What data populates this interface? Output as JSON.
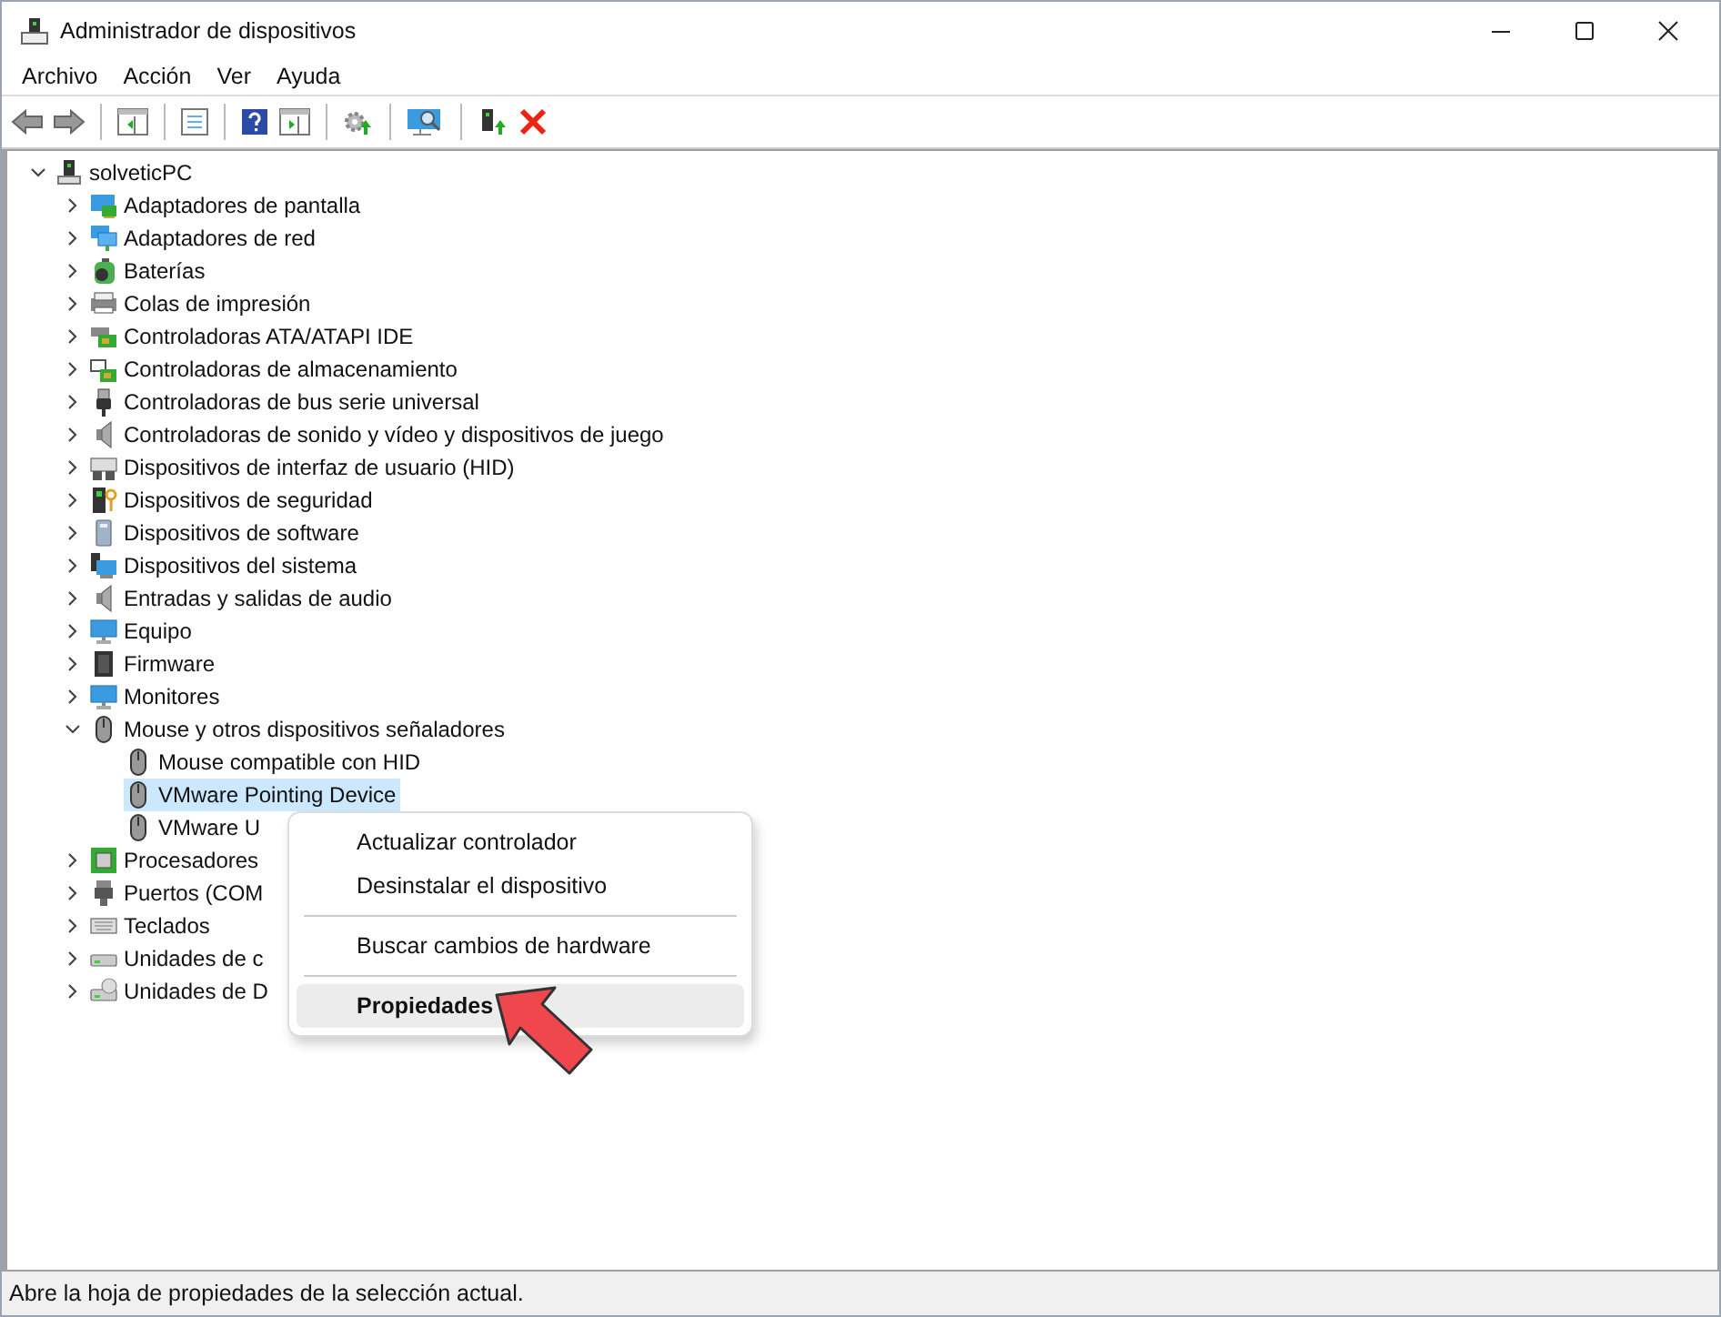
{
  "window": {
    "title": "Administrador de dispositivos"
  },
  "menu_bar": [
    "Archivo",
    "Acción",
    "Ver",
    "Ayuda"
  ],
  "tree": {
    "label": "solveticPC",
    "expanded": true,
    "selected": false,
    "children": [
      {
        "label": "Adaptadores de pantalla",
        "expanded": false,
        "selected": false
      },
      {
        "label": "Adaptadores de red",
        "expanded": false,
        "selected": false
      },
      {
        "label": "Baterías",
        "expanded": false,
        "selected": false
      },
      {
        "label": "Colas de impresión",
        "expanded": false,
        "selected": false
      },
      {
        "label": "Controladoras ATA/ATAPI IDE",
        "expanded": false,
        "selected": false
      },
      {
        "label": "Controladoras de almacenamiento",
        "expanded": false,
        "selected": false
      },
      {
        "label": "Controladoras de bus serie universal",
        "expanded": false,
        "selected": false
      },
      {
        "label": "Controladoras de sonido y vídeo y dispositivos de juego",
        "expanded": false,
        "selected": false
      },
      {
        "label": "Dispositivos de interfaz de usuario (HID)",
        "expanded": false,
        "selected": false
      },
      {
        "label": "Dispositivos de seguridad",
        "expanded": false,
        "selected": false
      },
      {
        "label": "Dispositivos de software",
        "expanded": false,
        "selected": false
      },
      {
        "label": "Dispositivos del sistema",
        "expanded": false,
        "selected": false
      },
      {
        "label": "Entradas y salidas de audio",
        "expanded": false,
        "selected": false
      },
      {
        "label": "Equipo",
        "expanded": false,
        "selected": false
      },
      {
        "label": "Firmware",
        "expanded": false,
        "selected": false
      },
      {
        "label": "Monitores",
        "expanded": false,
        "selected": false
      },
      {
        "label": "Mouse y otros dispositivos señaladores",
        "expanded": true,
        "selected": false,
        "children": [
          {
            "label": "Mouse compatible con HID",
            "selected": false
          },
          {
            "label": "VMware Pointing Device",
            "selected": true
          },
          {
            "label": "VMware U",
            "selected": false
          }
        ]
      },
      {
        "label": "Procesadores",
        "expanded": false,
        "selected": false
      },
      {
        "label": "Puertos (COM",
        "expanded": false,
        "selected": false
      },
      {
        "label": "Teclados",
        "expanded": false,
        "selected": false
      },
      {
        "label": "Unidades de c",
        "expanded": false,
        "selected": false
      },
      {
        "label": "Unidades de D",
        "expanded": false,
        "selected": false
      }
    ]
  },
  "context_menu": {
    "groups": [
      [
        {
          "label": "Actualizar controlador",
          "default": false,
          "highlighted": false
        },
        {
          "label": "Desinstalar el dispositivo",
          "default": false,
          "highlighted": false
        }
      ],
      [
        {
          "label": "Buscar cambios de hardware",
          "default": false,
          "highlighted": false
        }
      ],
      [
        {
          "label": "Propiedades",
          "default": true,
          "highlighted": true
        }
      ]
    ]
  },
  "status_bar": "Abre la hoja de propiedades de la selección actual."
}
